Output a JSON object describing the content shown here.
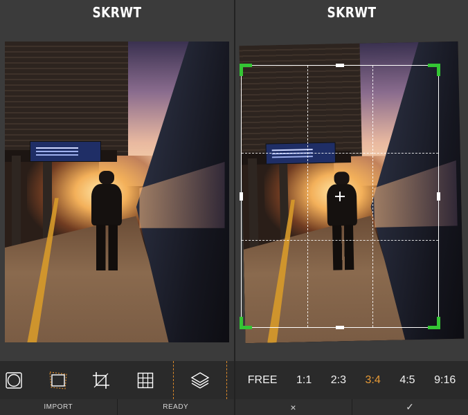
{
  "left": {
    "title": "SKRWT",
    "tools": [
      {
        "name": "lens-tool",
        "icon": "lens-circle-icon"
      },
      {
        "name": "perspective-tool",
        "icon": "perspective-square-icon"
      },
      {
        "name": "crop-tool",
        "icon": "crop-icon"
      },
      {
        "name": "grid-tool",
        "icon": "grid-icon"
      },
      {
        "name": "layers-tool",
        "icon": "layers-icon",
        "selected": true
      }
    ],
    "bottom": {
      "import_label": "IMPORT",
      "ready_label": "READY"
    }
  },
  "right": {
    "title": "SKRWT",
    "ratios": [
      "FREE",
      "1:1",
      "2:3",
      "3:4",
      "4:5",
      "9:16"
    ],
    "selected_ratio": "3:4",
    "bottom": {
      "cancel_label": "×",
      "confirm_label": "✓"
    }
  },
  "colors": {
    "accent": "#e79a36",
    "crop_corner": "#34c534",
    "toolbar_bg": "#2a2a2a",
    "panel_bg": "#3b3b3b"
  }
}
